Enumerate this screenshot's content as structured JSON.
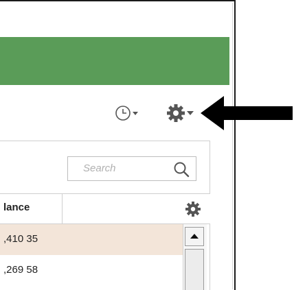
{
  "toolbar": {
    "history_icon": "clock-dropdown-icon",
    "settings_icon": "gear-dropdown-icon"
  },
  "search": {
    "placeholder": "Search",
    "icon": "search-icon"
  },
  "table": {
    "columns": [
      "lance"
    ],
    "column_settings_icon": "gear-icon",
    "rows": [
      {
        "value": ",410 35"
      },
      {
        "value": ",269 58"
      }
    ]
  },
  "colors": {
    "header_band": "#5a9c58",
    "highlight_row": "#f3e5d9",
    "annotation_arrow": "#000000"
  }
}
